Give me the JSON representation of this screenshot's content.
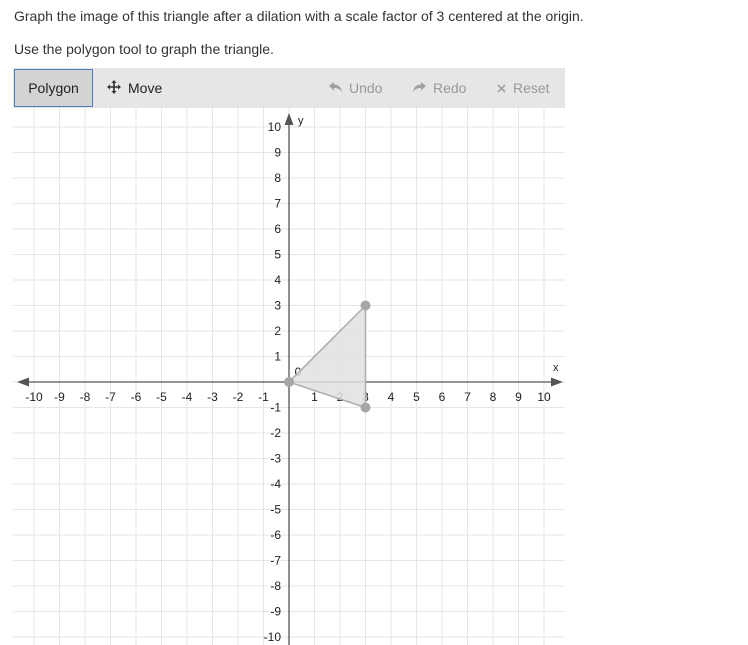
{
  "instructions": {
    "line1": "Graph the image of this triangle after a dilation with a scale factor of 3 centered at the origin.",
    "line2": "Use the polygon tool to graph the triangle."
  },
  "toolbar": {
    "polygon_label": "Polygon",
    "move_label": "Move",
    "undo_label": "Undo",
    "redo_label": "Redo",
    "reset_label": "Reset",
    "move_icon": "move-arrows-icon",
    "undo_icon": "undo-arrow-icon",
    "redo_icon": "redo-arrow-icon",
    "reset_icon": "x-icon"
  },
  "graph": {
    "x_axis_label": "x",
    "y_axis_label": "y",
    "x_range": [
      -10,
      10
    ],
    "y_range": [
      -10,
      10
    ],
    "grid": true,
    "x_tick_labels": [
      "-10",
      "-9",
      "-8",
      "-7",
      "-6",
      "-5",
      "-4",
      "-3",
      "-2",
      "-1",
      "1",
      "2",
      "3",
      "4",
      "5",
      "6",
      "7",
      "8",
      "9",
      "10"
    ],
    "y_tick_labels": [
      "10",
      "9",
      "8",
      "7",
      "6",
      "5",
      "4",
      "3",
      "2",
      "1",
      "-1",
      "-2",
      "-3",
      "-4",
      "-5",
      "-6",
      "-7",
      "-8",
      "-9",
      "-10"
    ],
    "origin_label": "0",
    "triangle": {
      "vertices": [
        [
          0,
          0
        ],
        [
          3,
          3
        ],
        [
          3,
          -1
        ]
      ],
      "fill": "#e0e0e0",
      "stroke": "#b0b0b0",
      "point_color": "#a6a6a6"
    },
    "colors": {
      "grid": "#e6e6e6",
      "axis": "#555555"
    }
  }
}
